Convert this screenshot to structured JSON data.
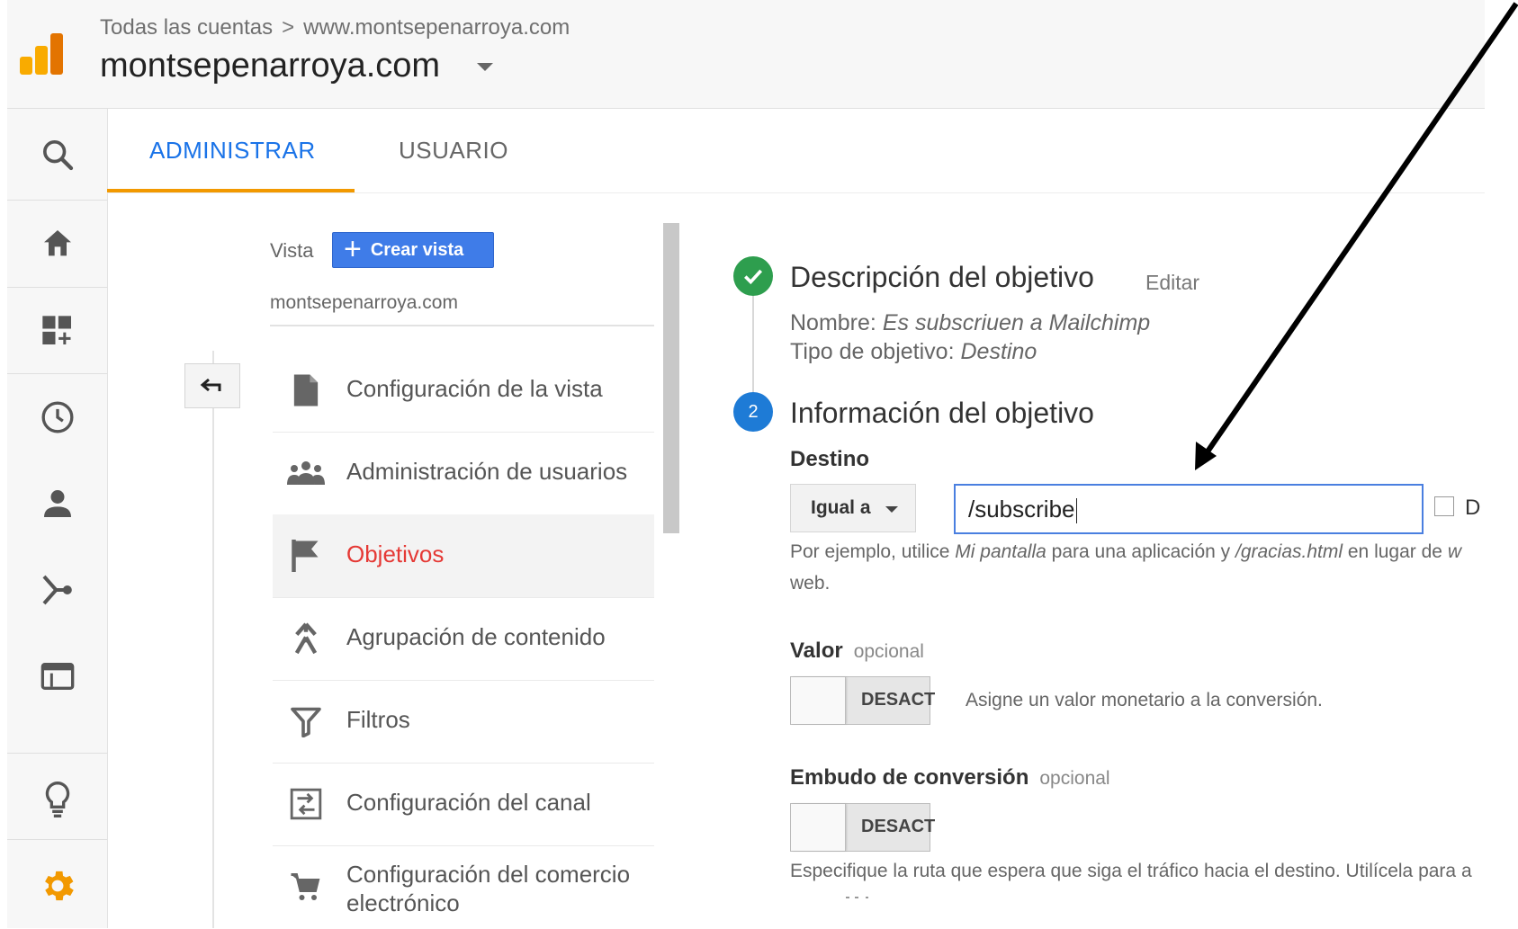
{
  "header": {
    "breadcrumb_root": "Todas las cuentas",
    "breadcrumb_separator": ">",
    "breadcrumb_site": "www.montsepenarroya.com",
    "account_title": "montsepenarroya.com"
  },
  "rail": {
    "icons": [
      "search-icon",
      "home-icon",
      "dashboard-add-icon",
      "clock-icon",
      "person-icon",
      "acquisition-icon",
      "behavior-icon",
      "lightbulb-icon",
      "gear-icon"
    ],
    "active_color": "#f29900"
  },
  "tabs": {
    "admin": "ADMINISTRAR",
    "user": "USUARIO",
    "active_color": "#1a73e8"
  },
  "view": {
    "label": "Vista",
    "create_button": "Crear vista",
    "name": "montsepenarroya.com",
    "menu": [
      {
        "label": "Configuración de la vista",
        "icon": "document-icon"
      },
      {
        "label": "Administración de usuarios",
        "icon": "users-icon"
      },
      {
        "label": "Objetivos",
        "icon": "flag-icon",
        "active": true
      },
      {
        "label": "Agrupación de contenido",
        "icon": "content-grouping-icon"
      },
      {
        "label": "Filtros",
        "icon": "filter-icon"
      },
      {
        "label": "Configuración del canal",
        "icon": "channel-icon"
      },
      {
        "label": "Configuración del comercio electrónico",
        "icon": "cart-icon"
      }
    ]
  },
  "goal": {
    "step1": {
      "title": "Descripción del objetivo",
      "edit": "Editar",
      "name_label": "Nombre:",
      "name_value": "Es subscriuen a Mailchimp",
      "type_label": "Tipo de objetivo:",
      "type_value": "Destino"
    },
    "step2": {
      "number": "2",
      "title": "Información del objetivo",
      "destination_label": "Destino",
      "match_type": "Igual a",
      "destination_value": "/subscribe",
      "case_label": "D",
      "hint_prefix": "Por ejemplo, utilice",
      "hint_example1": "Mi pantalla",
      "hint_middle": "para una aplicación y",
      "hint_example2": "/gracias.html",
      "hint_suffix": "en lugar de",
      "hint_cut": "w",
      "hint_line2": "web.",
      "value_label": "Valor",
      "optional": "opcional",
      "value_toggle": "DESACT",
      "value_desc": "Asigne un valor monetario a la conversión.",
      "funnel_label": "Embudo de conversión",
      "funnel_toggle": "DESACT",
      "funnel_desc": "Especifique la ruta que espera que siga el tráfico hacia el destino. Utilícela para a"
    }
  }
}
